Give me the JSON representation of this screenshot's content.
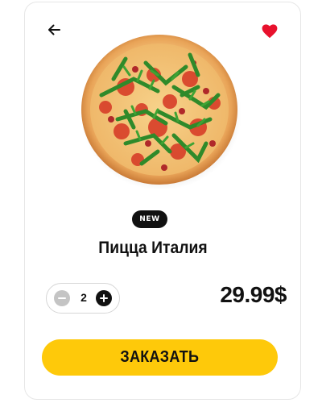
{
  "header": {
    "back_icon": "arrow-left-icon",
    "favorite_icon": "heart-icon",
    "favorite_color": "#e8112d"
  },
  "product": {
    "image": "pizza-photo",
    "badge": "NEW",
    "name": "Пицца Италия",
    "quantity": "2",
    "price": "29.99$"
  },
  "actions": {
    "minus_icon": "minus-icon",
    "plus_icon": "plus-icon",
    "order_label": "ЗАКАЗАТЬ"
  },
  "colors": {
    "accent": "#fec90a",
    "text": "#111111",
    "badge_bg": "#111111",
    "minus_bg": "#c4c4c4"
  }
}
